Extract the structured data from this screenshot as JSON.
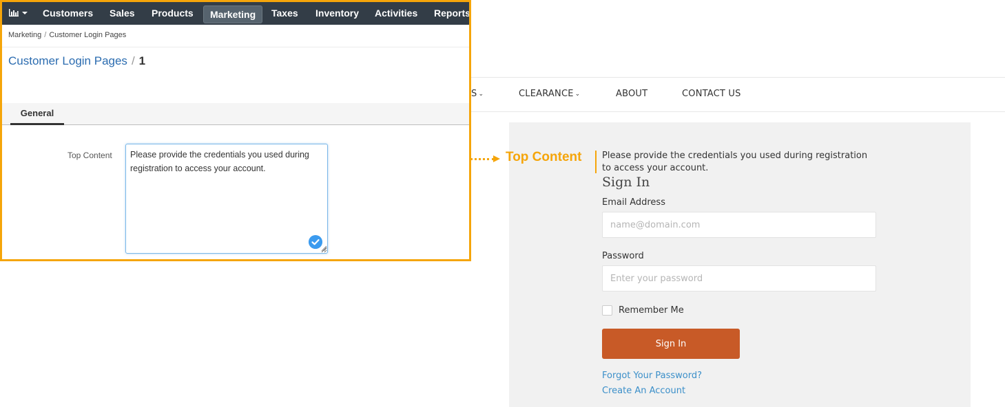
{
  "admin": {
    "nav": {
      "reports_icon": "bar-chart-icon",
      "items": [
        "Customers",
        "Sales",
        "Products",
        "Marketing",
        "Taxes",
        "Inventory",
        "Activities",
        "Reports"
      ],
      "active": "Marketing"
    },
    "breadcrumb": [
      "Marketing",
      "Customer Login Pages"
    ],
    "page_title": {
      "link": "Customer Login Pages",
      "separator": "/",
      "record": "1"
    },
    "tabs": [
      "General"
    ],
    "form": {
      "label": "Top Content",
      "value": "Please provide the credentials you used during registration to access your account."
    }
  },
  "callout": {
    "label": "Top Content",
    "color": "#f5a50a"
  },
  "storefront": {
    "nav": {
      "partial_item": "S",
      "clearance": "CLEARANCE",
      "about": "ABOUT",
      "contact": "CONTACT US"
    },
    "top_content": "Please provide the credentials you used during registration to access your account.",
    "title": "Sign In",
    "email": {
      "label": "Email Address",
      "placeholder": "name@domain.com"
    },
    "password": {
      "label": "Password",
      "placeholder": "Enter your password"
    },
    "remember": "Remember Me",
    "button": "Sign In",
    "button_color": "#c85a27",
    "forgot": "Forgot Your Password?",
    "create": "Create An Account"
  }
}
